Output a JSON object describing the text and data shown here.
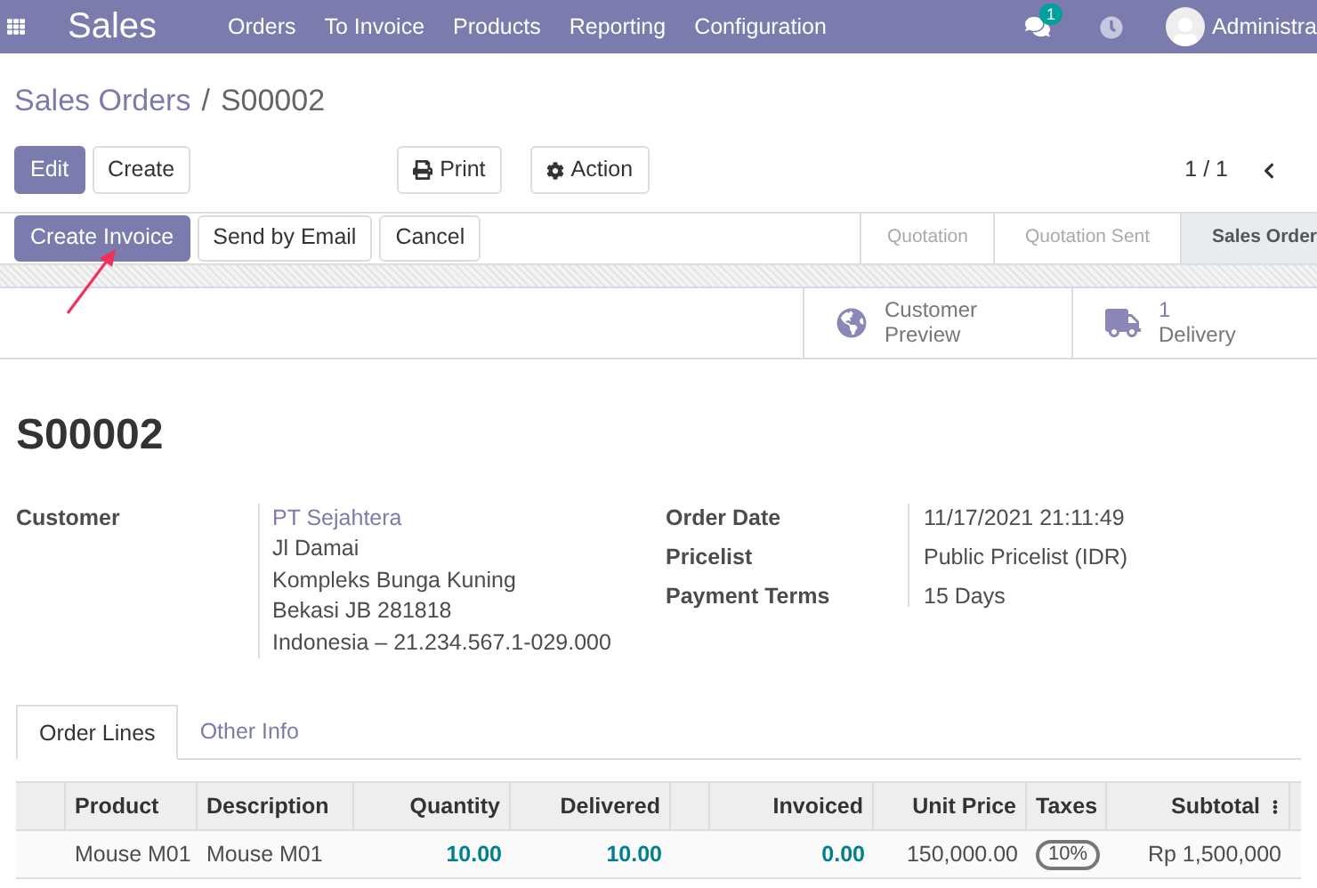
{
  "navbar": {
    "app_title": "Sales",
    "menu": [
      "Orders",
      "To Invoice",
      "Products",
      "Reporting",
      "Configuration"
    ],
    "message_count": "1",
    "user": "Administra"
  },
  "breadcrumb": {
    "parent": "Sales Orders",
    "separator": "/",
    "current": "S00002"
  },
  "control_buttons": [
    {
      "label": "Edit",
      "kind": "primary"
    },
    {
      "label": "Create",
      "kind": "default"
    }
  ],
  "action_buttons": [
    {
      "label": "Print",
      "kind": "print"
    },
    {
      "label": "Action",
      "kind": "gear"
    }
  ],
  "pager": "1 / 1",
  "header_buttons": [
    {
      "label": "Create Invoice",
      "kind": "primary"
    },
    {
      "label": "Send by Email",
      "kind": "default"
    },
    {
      "label": "Cancel",
      "kind": "default"
    }
  ],
  "status_steps": [
    {
      "label": "Quotation",
      "selected": false
    },
    {
      "label": "Quotation Sent",
      "selected": false
    },
    {
      "label": "Sales Order",
      "selected": true
    }
  ],
  "smart_buttons": [
    {
      "kind": "globe",
      "label": "Customer Preview"
    },
    {
      "kind": "truck",
      "value": "1",
      "label": "Delivery"
    }
  ],
  "title": "S00002",
  "customer": {
    "label": "Customer",
    "name": "PT Sejahtera",
    "address": [
      "Jl Damai",
      "Kompleks Bunga Kuning",
      "Bekasi JB 281818",
      "Indonesia – 21.234.567.1-029.000"
    ]
  },
  "fields": [
    {
      "label": "Order Date",
      "value": "11/17/2021 21:11:49"
    },
    {
      "label": "Pricelist",
      "value": "Public Pricelist (IDR)"
    },
    {
      "label": "Payment Terms",
      "value": "15 Days"
    }
  ],
  "tabs": [
    {
      "label": "Order Lines",
      "selected": true
    },
    {
      "label": "Other Info",
      "selected": false
    }
  ],
  "table": {
    "columns": [
      "Product",
      "Description",
      "Quantity",
      "Delivered",
      "Invoiced",
      "Unit Price",
      "Taxes",
      "Subtotal"
    ],
    "rows": [
      {
        "product": "Mouse M01",
        "description": "Mouse M01",
        "quantity": "10.00",
        "delivered": "10.00",
        "invoiced": "0.00",
        "unit_price": "150,000.00",
        "taxes": "10%",
        "subtotal": "Rp 1,500,000"
      }
    ]
  }
}
